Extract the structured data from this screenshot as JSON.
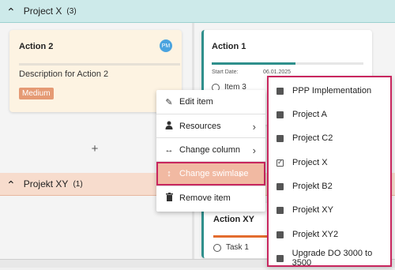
{
  "lanes": [
    {
      "name": "Project X",
      "count": "(3)"
    },
    {
      "name": "Projekt XY",
      "count": "(1)"
    }
  ],
  "cards": {
    "action2": {
      "title": "Action 2",
      "description": "Description for Action 2",
      "badge": "Medium",
      "avatar": "PM",
      "badge_color": "#e59a74"
    },
    "action1": {
      "title": "Action 1",
      "progress": 0.55,
      "start_label": "Start Date:",
      "start_value": "06.01.2025",
      "task": "Item 3"
    },
    "actionxy": {
      "title": "Action XY",
      "progress": 0.52,
      "task": "Task 1"
    }
  },
  "add_label": "+",
  "context_menu": {
    "items": [
      {
        "label": "Edit item",
        "icon": "pencil-icon"
      },
      {
        "label": "Resources",
        "icon": "person-icon"
      },
      {
        "label": "Change column",
        "icon": "horizontal-arrows-icon"
      },
      {
        "label": "Change swimlane",
        "icon": "vertical-arrows-icon"
      },
      {
        "label": "Remove item",
        "icon": "trash-icon"
      }
    ]
  },
  "submenu": {
    "items": [
      {
        "label": "PPP Implementation",
        "checked": false
      },
      {
        "label": "Project A",
        "checked": false
      },
      {
        "label": "Project C2",
        "checked": false
      },
      {
        "label": "Project X",
        "checked": true
      },
      {
        "label": "Projekt B2",
        "checked": false
      },
      {
        "label": "Projekt XY",
        "checked": false
      },
      {
        "label": "Projekt XY2",
        "checked": false
      },
      {
        "label": "Upgrade DO 3000 to 3500",
        "checked": false
      }
    ]
  },
  "colors": {
    "teal_lane": "#cdeaea",
    "orange_lane": "#f7dccd",
    "accent_teal": "#2f8f8c",
    "accent_orange": "#e36c2f",
    "highlight_border": "#c8265e"
  }
}
